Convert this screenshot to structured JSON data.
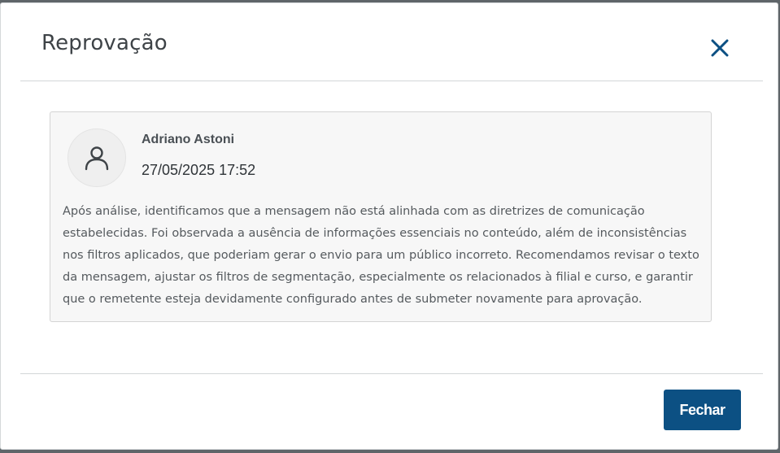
{
  "dialog": {
    "title": "Reprovação",
    "close_icon": "close-icon",
    "close_color": "#0c5083"
  },
  "comment": {
    "avatar_icon": "user-icon",
    "author": "Adriano Astoni",
    "timestamp": "27/05/2025 17:52",
    "message": "Após análise, identificamos que a mensagem não está alinhada com as diretrizes de comunicação estabelecidas. Foi observada a ausência de informações essenciais no conteúdo, além de inconsistências nos filtros aplicados, que poderiam gerar o envio para um público incorreto. Recomendamos revisar o texto da mensagem, ajustar os filtros de segmentação, especialmente os relacionados à filial e curso, e garantir que o remetente esteja devidamente configurado antes de submeter novamente para aprovação."
  },
  "footer": {
    "close_button_label": "Fechar",
    "button_color": "#0c5083"
  }
}
